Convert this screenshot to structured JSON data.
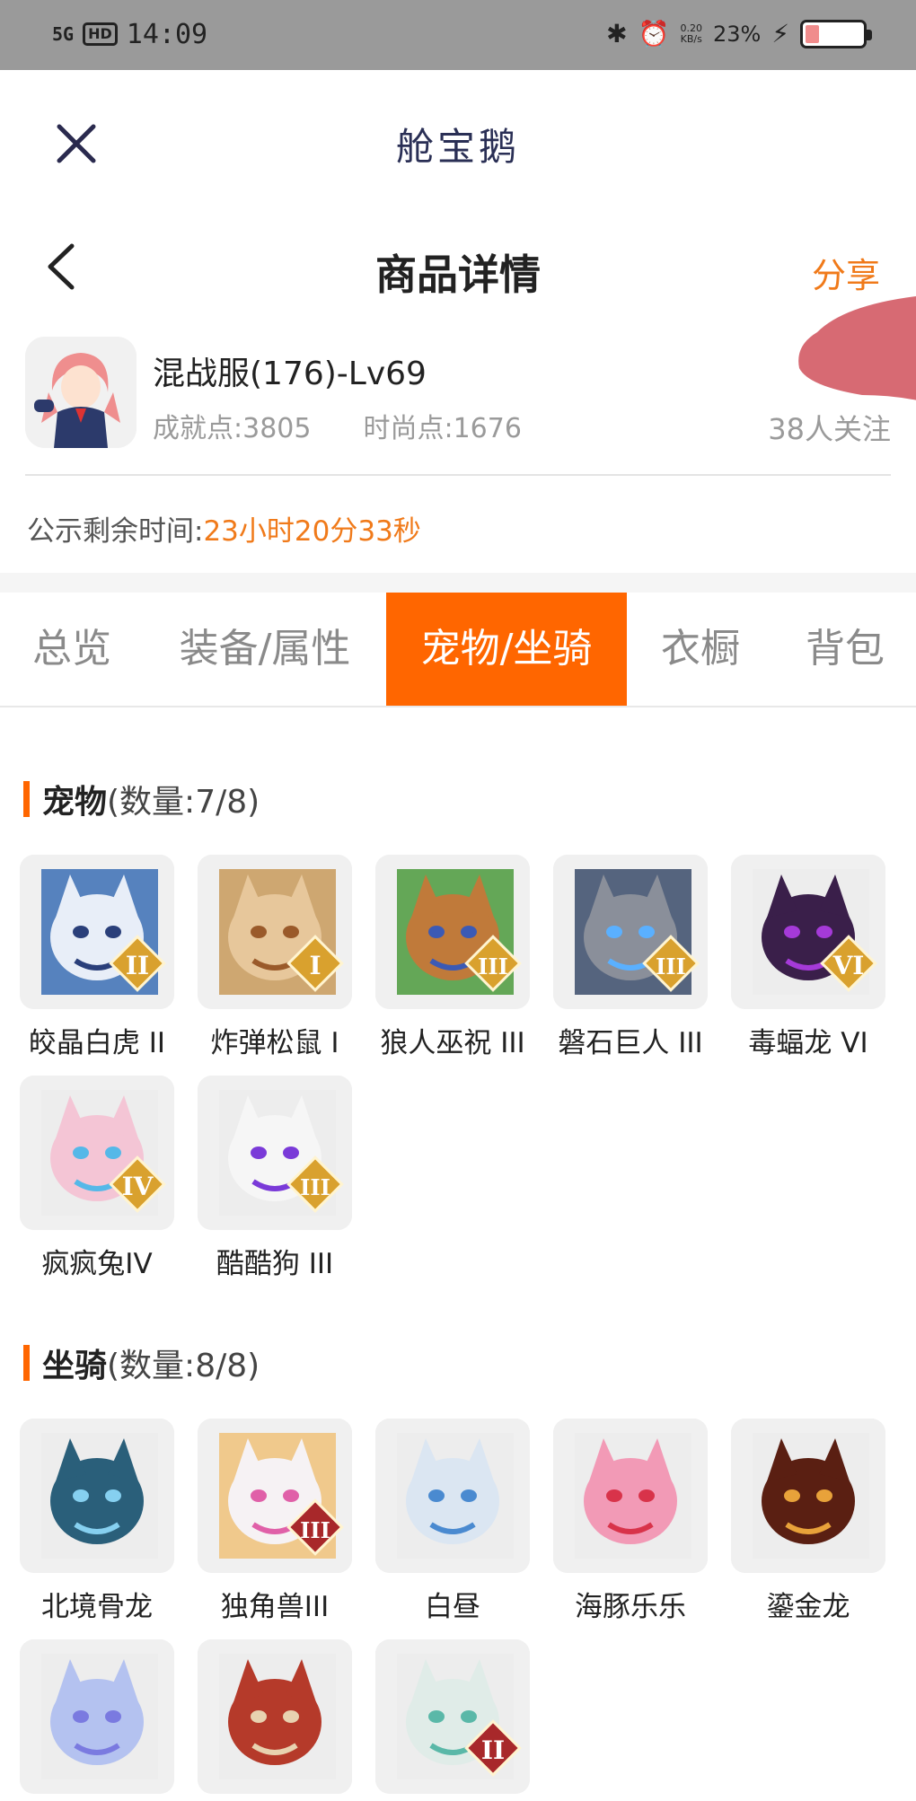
{
  "status_bar": {
    "signal": "5G",
    "hd": "HD",
    "time": "14:09",
    "speed_value": "0.20",
    "speed_unit": "KB/s",
    "battery": "23%"
  },
  "app": {
    "title": "舱宝鹅"
  },
  "detail": {
    "title": "商品详情",
    "share": "分享"
  },
  "product": {
    "name": "混战服(176)-Lv69",
    "achievement": "成就点:3805",
    "fashion": "时尚点:1676",
    "followers": "38人关注"
  },
  "countdown": {
    "label": "公示剩余时间:",
    "value": "23小时20分33秒"
  },
  "tabs": [
    {
      "label": "总览"
    },
    {
      "label": "装备/属性"
    },
    {
      "label": "宠物/坐骑"
    },
    {
      "label": "衣橱"
    },
    {
      "label": "背包"
    }
  ],
  "active_tab": "宠物/坐骑",
  "pets": {
    "title": "宠物",
    "count": "(数量:7/8)",
    "items": [
      {
        "label": "皎晶白虎 II",
        "rank": "II",
        "icon": "white-tiger-icon"
      },
      {
        "label": "炸弹松鼠 I",
        "rank": "I",
        "icon": "squirrel-icon"
      },
      {
        "label": "狼人巫祝 III",
        "rank": "III",
        "icon": "werewolf-shaman-icon"
      },
      {
        "label": "磐石巨人 III",
        "rank": "III",
        "icon": "rock-giant-icon"
      },
      {
        "label": "毒蝠龙 VI",
        "rank": "VI",
        "icon": "poison-bat-dragon-icon"
      },
      {
        "label": "疯疯兔IV",
        "rank": "IV",
        "icon": "crazy-rabbit-icon"
      },
      {
        "label": "酷酷狗 III",
        "rank": "III",
        "icon": "cool-dog-icon"
      }
    ]
  },
  "mounts": {
    "title": "坐骑",
    "count": "(数量:8/8)",
    "items": [
      {
        "label": "北境骨龙",
        "rank": "",
        "icon": "bone-dragon-icon"
      },
      {
        "label": "独角兽III",
        "rank": "III",
        "icon": "unicorn-icon"
      },
      {
        "label": "白昼",
        "rank": "",
        "icon": "white-dragon-icon"
      },
      {
        "label": "海豚乐乐",
        "rank": "",
        "icon": "dolphin-icon"
      },
      {
        "label": "鎏金龙",
        "rank": "",
        "icon": "golden-dragon-icon"
      },
      {
        "label": "",
        "rank": "",
        "icon": "spirit-fox-icon"
      },
      {
        "label": "",
        "rank": "",
        "icon": "red-dinosaur-icon"
      },
      {
        "label": "",
        "rank": "II",
        "icon": "white-deer-icon"
      }
    ]
  },
  "colors": {
    "accent": "#ff6600",
    "share": "#f07a1a",
    "status_bar": "#9a9a9a"
  }
}
